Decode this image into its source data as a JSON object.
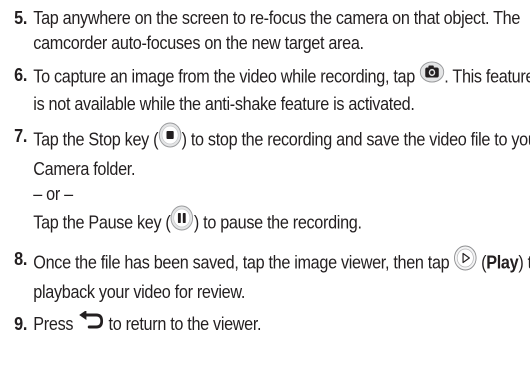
{
  "steps": [
    {
      "number": "5.",
      "text": "Tap anywhere on the screen to re-focus the camera on that object. The camcorder auto-focuses on the new target area."
    },
    {
      "number": "6.",
      "text_before_icon": "To capture an image from the video while recording, tap",
      "icon": "camera-icon",
      "text_after_icon": ".",
      "text_continued": "This feature is not available while the anti-shake feature is activated."
    },
    {
      "number": "7.",
      "stop_text_before": "Tap the Stop key (",
      "stop_icon": "stop-icon",
      "stop_text_after": ") to stop the recording and save the video file to your Camera folder.",
      "or_text": "– or –",
      "pause_text_before": "Tap the Pause key (",
      "pause_icon": "pause-icon",
      "pause_text_after": ") to pause the recording."
    },
    {
      "number": "8.",
      "text_before_icon": "Once the file has been saved, tap the image viewer, then tap",
      "icon": "play-icon",
      "play_open": "(",
      "play_label": "Play",
      "play_close": ")",
      "text_after_icon": "to playback your video for review."
    },
    {
      "number": "9.",
      "text_before_icon": "Press",
      "icon": "back-arrow-icon",
      "text_after_icon": "to return to the viewer."
    }
  ]
}
